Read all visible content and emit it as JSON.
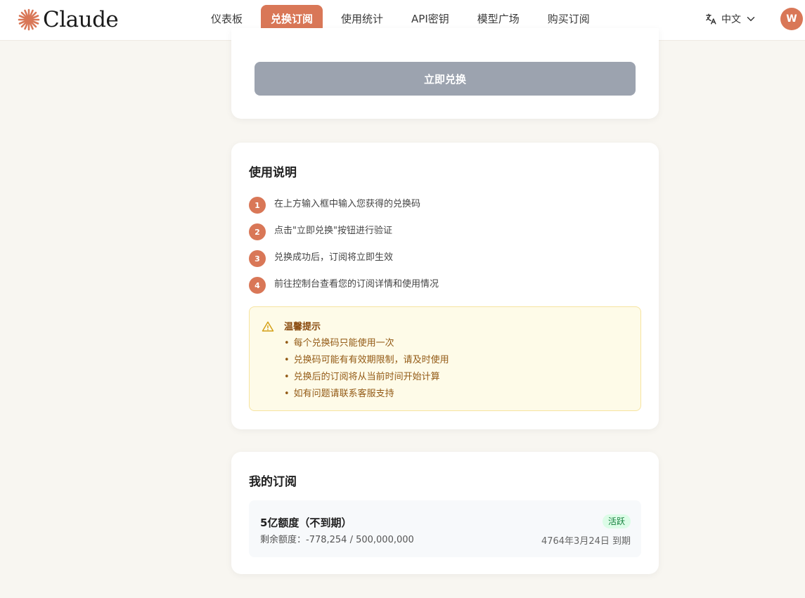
{
  "brand": {
    "name": "Claude",
    "color": "#d97757"
  },
  "nav": {
    "items": [
      {
        "label": "仪表板"
      },
      {
        "label": "兑换订阅"
      },
      {
        "label": "使用统计"
      },
      {
        "label": "API密钥"
      },
      {
        "label": "模型广场"
      },
      {
        "label": "购买订阅"
      }
    ],
    "active_index": 1
  },
  "language": {
    "label": "中文",
    "icon": "translate-icon"
  },
  "user": {
    "avatar_initial": "W"
  },
  "redeem": {
    "button_label": "立即兑换"
  },
  "guide": {
    "title": "使用说明",
    "steps": [
      {
        "num": "1",
        "text": "在上方输入框中输入您获得的兑换码"
      },
      {
        "num": "2",
        "text": "点击\"立即兑换\"按钮进行验证"
      },
      {
        "num": "3",
        "text": "兑换成功后，订阅将立即生效"
      },
      {
        "num": "4",
        "text": "前往控制台查看您的订阅详情和使用情况"
      }
    ],
    "tip": {
      "title": "温馨提示",
      "icon": "warning-icon",
      "items": [
        "每个兑换码只能使用一次",
        "兑换码可能有有效期限制，请及时使用",
        "兑换后的订阅将从当前时间开始计算",
        "如有问题请联系客服支持"
      ]
    }
  },
  "subscriptions": {
    "title": "我的订阅",
    "items": [
      {
        "name": "5亿额度（不到期）",
        "remaining": "剩余额度：-778,254 / 500,000,000",
        "status": "活跃",
        "expiry": "4764年3月24日 到期"
      }
    ]
  }
}
